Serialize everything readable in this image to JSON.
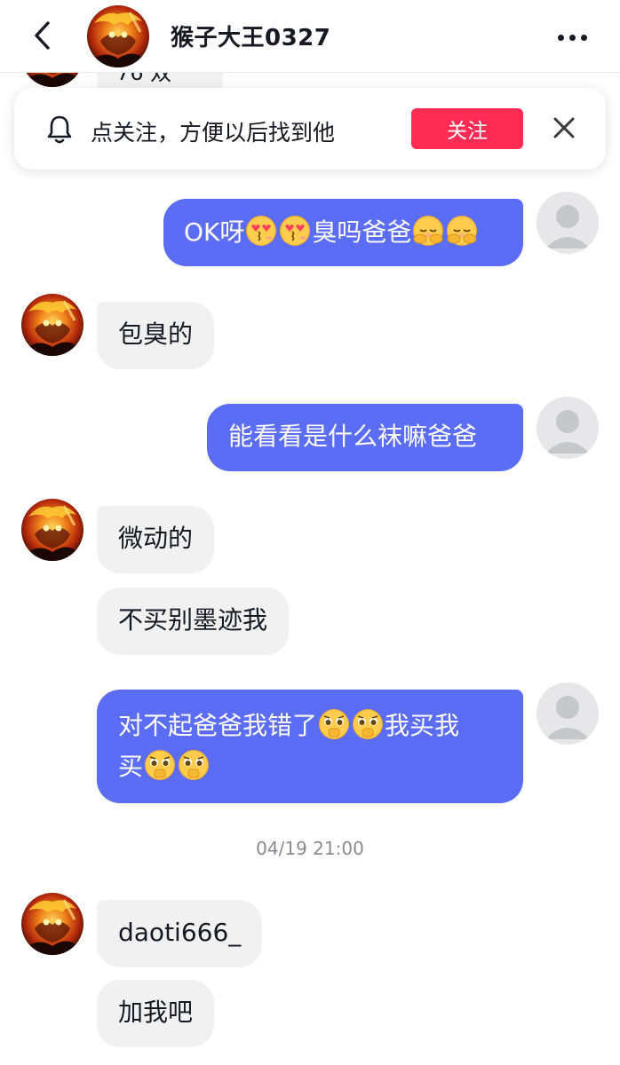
{
  "header": {
    "title": "猴子大王0327",
    "avatar_icon": "monkey-king-avatar",
    "back_icon": "chevron-left-icon",
    "more_icon": "more-dots-icon"
  },
  "partial_message": {
    "text": "76 双"
  },
  "follow_banner": {
    "text": "点关注，方便以后找到他",
    "button_label": "关注",
    "bell_icon": "bell-icon",
    "close_icon": "close-icon",
    "accent": "#fe2c55"
  },
  "messages": [
    {
      "side": "right",
      "text": "OK呀",
      "text_after": "臭吗爸爸",
      "emojis_a": [
        "heart-eyes-kiss-emoji",
        "heart-eyes-kiss-emoji"
      ],
      "emojis_b": [
        "covering-face-emoji",
        "covering-face-emoji"
      ]
    },
    {
      "side": "left",
      "text": "包臭的"
    },
    {
      "side": "right",
      "text": "能看看是什么袜嘛爸爸"
    },
    {
      "side": "left",
      "text": "微动的"
    },
    {
      "side": "left",
      "text": "不买别墨迹我"
    },
    {
      "side": "right",
      "line1": "对不起爸爸我错了",
      "line1_after": "我买我",
      "line2": "买",
      "emoji": "pleading-hands-emoji"
    }
  ],
  "timestamp": "04/19 21:00",
  "messages_after": [
    {
      "side": "left",
      "text": "daoti666_"
    },
    {
      "side": "left",
      "text": "加我吧"
    }
  ],
  "colors": {
    "outgoing_bubble": "#5b6cf5",
    "incoming_bubble": "#f1f1f2",
    "text": "#161823",
    "muted": "#8a8b91"
  }
}
